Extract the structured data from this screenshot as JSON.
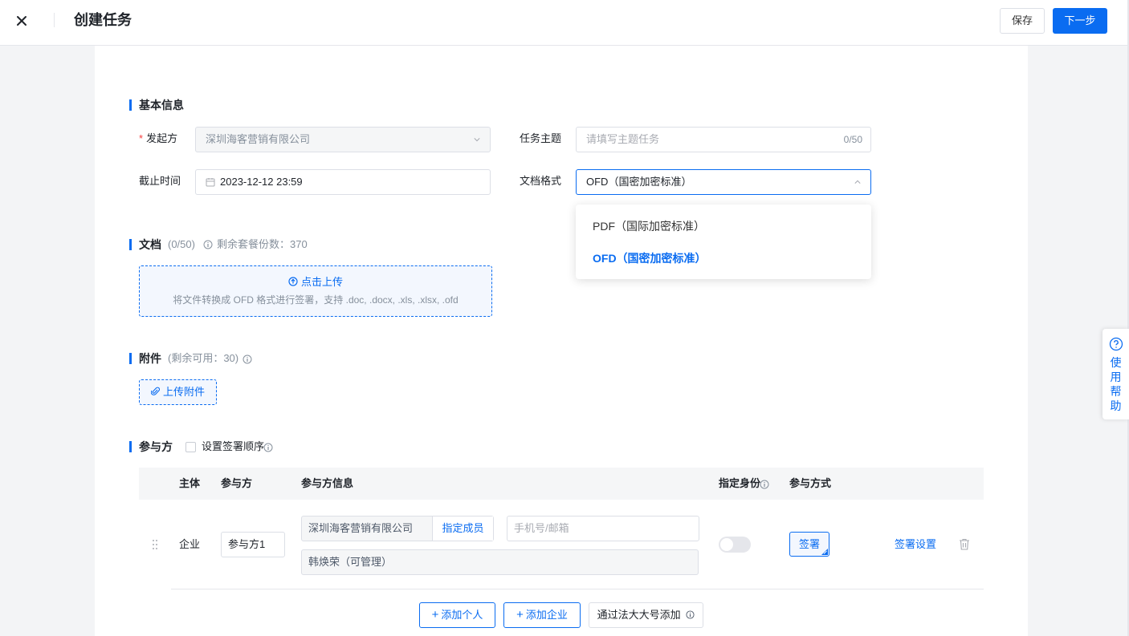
{
  "header": {
    "title": "创建任务",
    "save_label": "保存",
    "next_label": "下一步"
  },
  "basic_info": {
    "section_title": "基本信息",
    "initiator_label": "发起方",
    "initiator_required": "*",
    "initiator_value": "深圳海客营销有限公司",
    "subject_label": "任务主题",
    "subject_placeholder": "请填写主题任务",
    "subject_counter": "0/50",
    "deadline_label": "截止时间",
    "deadline_value": "2023-12-12 23:59",
    "format_label": "文档格式",
    "format_value": "OFD（国密加密标准）",
    "format_options": [
      {
        "label": "PDF（国际加密标准）",
        "selected": false
      },
      {
        "label": "OFD（国密加密标准）",
        "selected": true
      }
    ]
  },
  "documents": {
    "section_title": "文档",
    "count": "(0/50)",
    "remaining": "剩余套餐份数：370",
    "upload_label": "点击上传",
    "upload_hint": "将文件转换成 OFD 格式进行签署，支持 .doc, .docx, .xls, .xlsx, .ofd"
  },
  "attachments": {
    "section_title": "附件",
    "remaining": "(剩余可用：30)",
    "upload_label": "上传附件"
  },
  "participants": {
    "section_title": "参与方",
    "order_checkbox_label": "设置签署顺序",
    "columns": [
      "主体",
      "参与方",
      "参与方信息",
      "指定身份",
      "参与方式"
    ],
    "rows": [
      {
        "subject": "企业",
        "party_name": "参与方1",
        "company": "深圳海客营销有限公司",
        "assign_member_label": "指定成员",
        "contact_placeholder": "手机号/邮箱",
        "member": "韩焕荣（可管理）",
        "identity_enabled": false,
        "mode_label": "签署",
        "settings_label": "签署设置"
      }
    ],
    "add_person_label": "添加个人",
    "add_company_label": "添加企业",
    "add_fadada_label": "通过法大大号添加"
  },
  "help": {
    "label": "使用帮助"
  },
  "colors": {
    "primary": "#0a6cf1",
    "required": "#f53f3f"
  }
}
